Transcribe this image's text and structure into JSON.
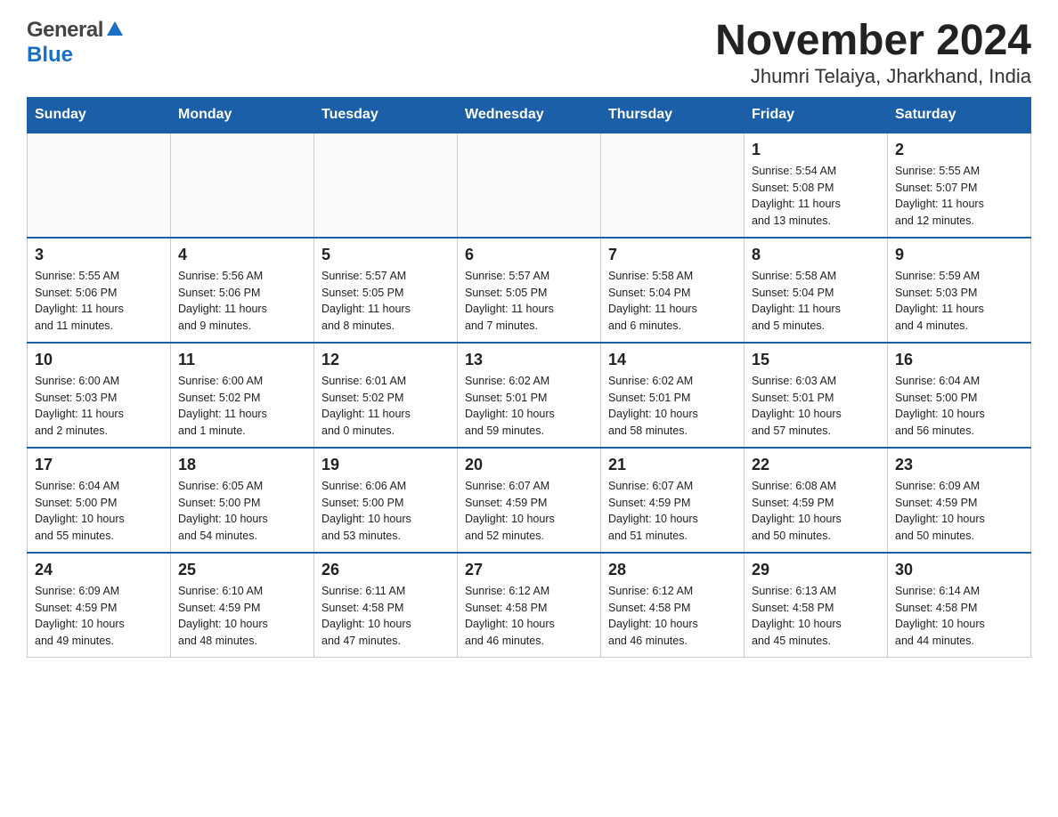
{
  "header": {
    "logo_general": "General",
    "logo_blue": "Blue",
    "title": "November 2024",
    "subtitle": "Jhumri Telaiya, Jharkhand, India"
  },
  "days_of_week": [
    "Sunday",
    "Monday",
    "Tuesday",
    "Wednesday",
    "Thursday",
    "Friday",
    "Saturday"
  ],
  "weeks": [
    [
      {
        "day": "",
        "info": ""
      },
      {
        "day": "",
        "info": ""
      },
      {
        "day": "",
        "info": ""
      },
      {
        "day": "",
        "info": ""
      },
      {
        "day": "",
        "info": ""
      },
      {
        "day": "1",
        "info": "Sunrise: 5:54 AM\nSunset: 5:08 PM\nDaylight: 11 hours\nand 13 minutes."
      },
      {
        "day": "2",
        "info": "Sunrise: 5:55 AM\nSunset: 5:07 PM\nDaylight: 11 hours\nand 12 minutes."
      }
    ],
    [
      {
        "day": "3",
        "info": "Sunrise: 5:55 AM\nSunset: 5:06 PM\nDaylight: 11 hours\nand 11 minutes."
      },
      {
        "day": "4",
        "info": "Sunrise: 5:56 AM\nSunset: 5:06 PM\nDaylight: 11 hours\nand 9 minutes."
      },
      {
        "day": "5",
        "info": "Sunrise: 5:57 AM\nSunset: 5:05 PM\nDaylight: 11 hours\nand 8 minutes."
      },
      {
        "day": "6",
        "info": "Sunrise: 5:57 AM\nSunset: 5:05 PM\nDaylight: 11 hours\nand 7 minutes."
      },
      {
        "day": "7",
        "info": "Sunrise: 5:58 AM\nSunset: 5:04 PM\nDaylight: 11 hours\nand 6 minutes."
      },
      {
        "day": "8",
        "info": "Sunrise: 5:58 AM\nSunset: 5:04 PM\nDaylight: 11 hours\nand 5 minutes."
      },
      {
        "day": "9",
        "info": "Sunrise: 5:59 AM\nSunset: 5:03 PM\nDaylight: 11 hours\nand 4 minutes."
      }
    ],
    [
      {
        "day": "10",
        "info": "Sunrise: 6:00 AM\nSunset: 5:03 PM\nDaylight: 11 hours\nand 2 minutes."
      },
      {
        "day": "11",
        "info": "Sunrise: 6:00 AM\nSunset: 5:02 PM\nDaylight: 11 hours\nand 1 minute."
      },
      {
        "day": "12",
        "info": "Sunrise: 6:01 AM\nSunset: 5:02 PM\nDaylight: 11 hours\nand 0 minutes."
      },
      {
        "day": "13",
        "info": "Sunrise: 6:02 AM\nSunset: 5:01 PM\nDaylight: 10 hours\nand 59 minutes."
      },
      {
        "day": "14",
        "info": "Sunrise: 6:02 AM\nSunset: 5:01 PM\nDaylight: 10 hours\nand 58 minutes."
      },
      {
        "day": "15",
        "info": "Sunrise: 6:03 AM\nSunset: 5:01 PM\nDaylight: 10 hours\nand 57 minutes."
      },
      {
        "day": "16",
        "info": "Sunrise: 6:04 AM\nSunset: 5:00 PM\nDaylight: 10 hours\nand 56 minutes."
      }
    ],
    [
      {
        "day": "17",
        "info": "Sunrise: 6:04 AM\nSunset: 5:00 PM\nDaylight: 10 hours\nand 55 minutes."
      },
      {
        "day": "18",
        "info": "Sunrise: 6:05 AM\nSunset: 5:00 PM\nDaylight: 10 hours\nand 54 minutes."
      },
      {
        "day": "19",
        "info": "Sunrise: 6:06 AM\nSunset: 5:00 PM\nDaylight: 10 hours\nand 53 minutes."
      },
      {
        "day": "20",
        "info": "Sunrise: 6:07 AM\nSunset: 4:59 PM\nDaylight: 10 hours\nand 52 minutes."
      },
      {
        "day": "21",
        "info": "Sunrise: 6:07 AM\nSunset: 4:59 PM\nDaylight: 10 hours\nand 51 minutes."
      },
      {
        "day": "22",
        "info": "Sunrise: 6:08 AM\nSunset: 4:59 PM\nDaylight: 10 hours\nand 50 minutes."
      },
      {
        "day": "23",
        "info": "Sunrise: 6:09 AM\nSunset: 4:59 PM\nDaylight: 10 hours\nand 50 minutes."
      }
    ],
    [
      {
        "day": "24",
        "info": "Sunrise: 6:09 AM\nSunset: 4:59 PM\nDaylight: 10 hours\nand 49 minutes."
      },
      {
        "day": "25",
        "info": "Sunrise: 6:10 AM\nSunset: 4:59 PM\nDaylight: 10 hours\nand 48 minutes."
      },
      {
        "day": "26",
        "info": "Sunrise: 6:11 AM\nSunset: 4:58 PM\nDaylight: 10 hours\nand 47 minutes."
      },
      {
        "day": "27",
        "info": "Sunrise: 6:12 AM\nSunset: 4:58 PM\nDaylight: 10 hours\nand 46 minutes."
      },
      {
        "day": "28",
        "info": "Sunrise: 6:12 AM\nSunset: 4:58 PM\nDaylight: 10 hours\nand 46 minutes."
      },
      {
        "day": "29",
        "info": "Sunrise: 6:13 AM\nSunset: 4:58 PM\nDaylight: 10 hours\nand 45 minutes."
      },
      {
        "day": "30",
        "info": "Sunrise: 6:14 AM\nSunset: 4:58 PM\nDaylight: 10 hours\nand 44 minutes."
      }
    ]
  ]
}
